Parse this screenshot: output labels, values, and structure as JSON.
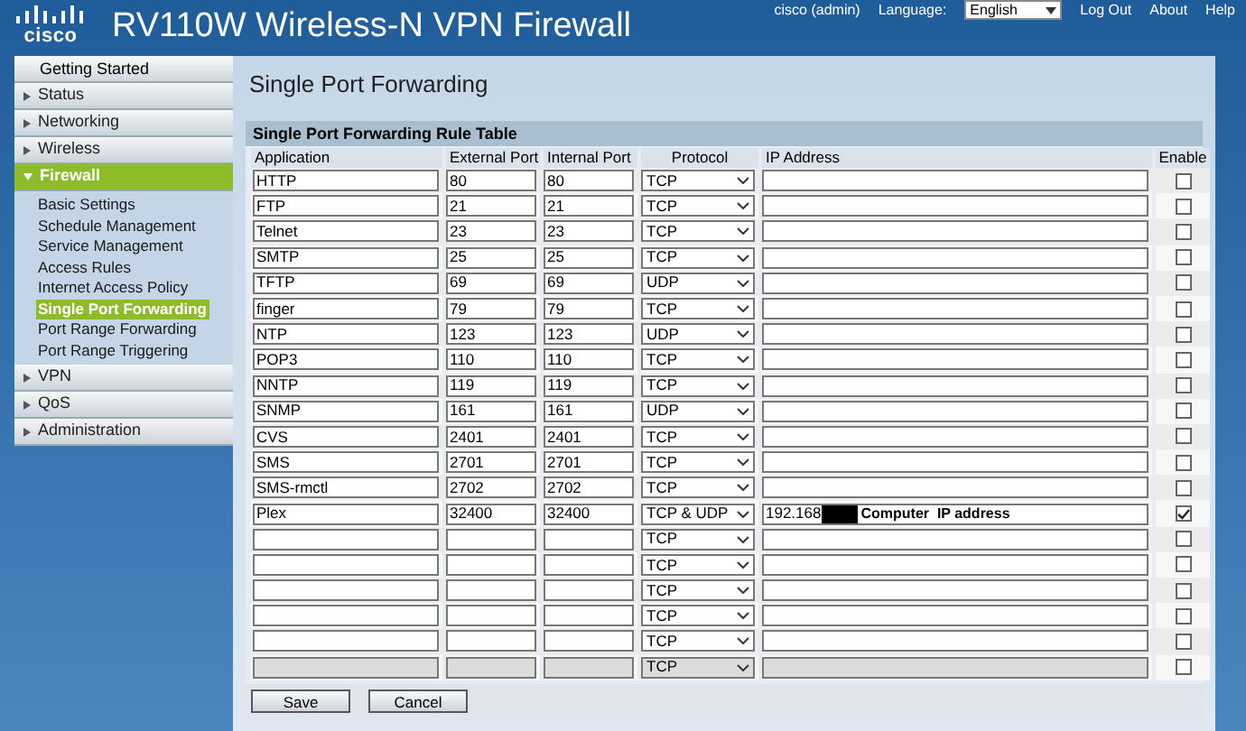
{
  "header": {
    "logo": "cisco",
    "title": "RV110W Wireless-N VPN Firewall",
    "user": "cisco (admin)",
    "language_label": "Language:",
    "language": "English",
    "links": [
      "Log Out",
      "About",
      "Help"
    ]
  },
  "nav": [
    {
      "label": "Getting Started",
      "kind": "link"
    },
    {
      "label": "Status",
      "kind": "section",
      "expanded": false
    },
    {
      "label": "Networking",
      "kind": "section",
      "expanded": false
    },
    {
      "label": "Wireless",
      "kind": "section",
      "expanded": false
    },
    {
      "label": "Firewall",
      "kind": "section",
      "expanded": true,
      "children": [
        {
          "label": "Basic Settings",
          "selected": false
        },
        {
          "label": "Schedule Management",
          "selected": false
        },
        {
          "label": "Service Management",
          "selected": false
        },
        {
          "label": "Access Rules",
          "selected": false
        },
        {
          "label": "Internet Access Policy",
          "selected": false
        },
        {
          "label": "Single Port Forwarding",
          "selected": true
        },
        {
          "label": "Port Range Forwarding",
          "selected": false
        },
        {
          "label": "Port Range Triggering",
          "selected": false
        }
      ]
    },
    {
      "label": "VPN",
      "kind": "section",
      "expanded": false
    },
    {
      "label": "QoS",
      "kind": "section",
      "expanded": false
    },
    {
      "label": "Administration",
      "kind": "section",
      "expanded": false
    }
  ],
  "page_title": "Single Port Forwarding",
  "table": {
    "title": "Single Port Forwarding Rule Table",
    "columns": [
      "Application",
      "External Port",
      "Internal Port",
      "Protocol",
      "IP Address",
      "Enable"
    ],
    "rows": [
      {
        "application": "HTTP",
        "external_port": "80",
        "internal_port": "80",
        "protocol": "TCP",
        "enabled": false,
        "disabled": false,
        "redacted": false
      },
      {
        "application": "FTP",
        "external_port": "21",
        "internal_port": "21",
        "protocol": "TCP",
        "enabled": false,
        "disabled": false,
        "redacted": false
      },
      {
        "application": "Telnet",
        "external_port": "23",
        "internal_port": "23",
        "protocol": "TCP",
        "enabled": false,
        "disabled": false,
        "redacted": false
      },
      {
        "application": "SMTP",
        "external_port": "25",
        "internal_port": "25",
        "protocol": "TCP",
        "enabled": false,
        "disabled": false,
        "redacted": false
      },
      {
        "application": "TFTP",
        "external_port": "69",
        "internal_port": "69",
        "protocol": "UDP",
        "enabled": false,
        "disabled": false,
        "redacted": false
      },
      {
        "application": "finger",
        "external_port": "79",
        "internal_port": "79",
        "protocol": "TCP",
        "enabled": false,
        "disabled": false,
        "redacted": false
      },
      {
        "application": "NTP",
        "external_port": "123",
        "internal_port": "123",
        "protocol": "UDP",
        "enabled": false,
        "disabled": false,
        "redacted": false
      },
      {
        "application": "POP3",
        "external_port": "110",
        "internal_port": "110",
        "protocol": "TCP",
        "enabled": false,
        "disabled": false,
        "redacted": false
      },
      {
        "application": "NNTP",
        "external_port": "119",
        "internal_port": "119",
        "protocol": "TCP",
        "enabled": false,
        "disabled": false,
        "redacted": false
      },
      {
        "application": "SNMP",
        "external_port": "161",
        "internal_port": "161",
        "protocol": "UDP",
        "enabled": false,
        "disabled": false,
        "redacted": false
      },
      {
        "application": "CVS",
        "external_port": "2401",
        "internal_port": "2401",
        "protocol": "TCP",
        "enabled": false,
        "disabled": false,
        "redacted": false
      },
      {
        "application": "SMS",
        "external_port": "2701",
        "internal_port": "2701",
        "protocol": "TCP",
        "enabled": false,
        "disabled": false,
        "redacted": false
      },
      {
        "application": "SMS-rmctl",
        "external_port": "2702",
        "internal_port": "2702",
        "protocol": "TCP",
        "enabled": false,
        "disabled": false,
        "redacted": false
      },
      {
        "application": "Plex",
        "external_port": "32400",
        "internal_port": "32400",
        "protocol": "TCP & UDP",
        "ip_address": "192.168",
        "note": "Computer  IP address",
        "enabled": true,
        "disabled": false,
        "redacted": true
      },
      {
        "protocol": "TCP",
        "enabled": false,
        "disabled": false,
        "redacted": false
      },
      {
        "protocol": "TCP",
        "enabled": false,
        "disabled": false,
        "redacted": false
      },
      {
        "protocol": "TCP",
        "enabled": false,
        "disabled": false,
        "redacted": false
      },
      {
        "protocol": "TCP",
        "enabled": false,
        "disabled": false,
        "redacted": false
      },
      {
        "protocol": "TCP",
        "enabled": false,
        "disabled": false,
        "redacted": false
      },
      {
        "protocol": "TCP",
        "enabled": false,
        "disabled": true,
        "redacted": false
      }
    ]
  },
  "buttons": [
    "Save",
    "Cancel"
  ]
}
